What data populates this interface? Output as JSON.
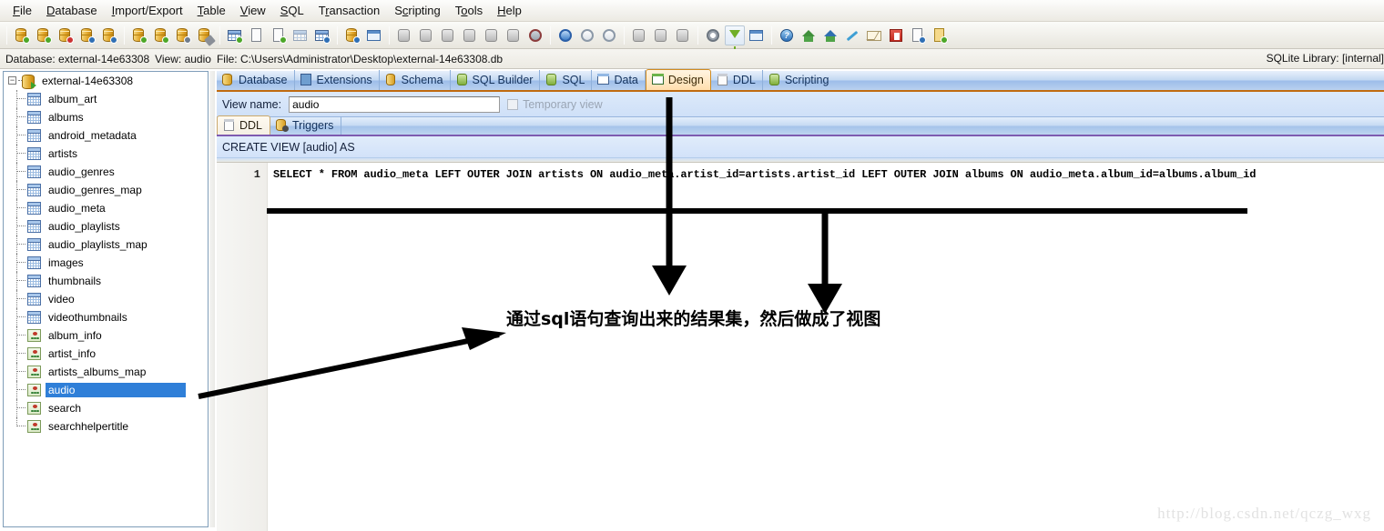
{
  "menubar": {
    "items": [
      {
        "label": "File",
        "acc": "F"
      },
      {
        "label": "Database",
        "acc": "D"
      },
      {
        "label": "Import/Export",
        "acc": "I"
      },
      {
        "label": "Table",
        "acc": "T"
      },
      {
        "label": "View",
        "acc": "V"
      },
      {
        "label": "SQL",
        "acc": "S"
      },
      {
        "label": "Transaction",
        "acc": "r"
      },
      {
        "label": "Scripting",
        "acc": "c"
      },
      {
        "label": "Tools",
        "acc": "o"
      },
      {
        "label": "Help",
        "acc": "H"
      }
    ]
  },
  "toolbar": {
    "groups": [
      {
        "buttons": [
          {
            "name": "open-database",
            "icon": "database-open-icon"
          },
          {
            "name": "new-database",
            "icon": "database-add-icon"
          },
          {
            "name": "close-database",
            "icon": "database-remove-icon"
          },
          {
            "name": "database-settings",
            "icon": "database-gear-icon"
          },
          {
            "name": "database-info",
            "icon": "database-info-icon"
          }
        ]
      },
      {
        "buttons": [
          {
            "name": "attach-database",
            "icon": "database-attach-icon"
          },
          {
            "name": "detach-database",
            "icon": "database-detach-icon"
          },
          {
            "name": "compact-database",
            "icon": "database-compact-icon"
          },
          {
            "name": "repair-database",
            "icon": "database-wrench-icon"
          }
        ]
      },
      {
        "buttons": [
          {
            "name": "new-table",
            "icon": "table-add-icon"
          },
          {
            "name": "rename-table",
            "icon": "table-text-icon"
          },
          {
            "name": "copy-table",
            "icon": "table-copy-icon"
          },
          {
            "name": "drop-table",
            "icon": "table-delete-icon"
          },
          {
            "name": "design-table",
            "icon": "table-design-icon"
          }
        ]
      },
      {
        "buttons": [
          {
            "name": "import-data",
            "icon": "import-icon"
          },
          {
            "name": "export-data",
            "icon": "export-calendar-icon"
          }
        ]
      },
      {
        "buttons": [
          {
            "name": "execute-sql-1",
            "icon": "sql-script-icon"
          },
          {
            "name": "execute-sql-2",
            "icon": "sql-script-icon"
          },
          {
            "name": "execute-sql-3",
            "icon": "sql-script-icon"
          },
          {
            "name": "execute-sql-4",
            "icon": "sql-script-icon"
          },
          {
            "name": "execute-sql-5",
            "icon": "sql-script-icon"
          },
          {
            "name": "execute-sql-6",
            "icon": "sql-script-icon"
          },
          {
            "name": "stop-sql",
            "icon": "stop-icon"
          }
        ]
      },
      {
        "buttons": [
          {
            "name": "transaction-begin",
            "icon": "transaction-begin-icon"
          },
          {
            "name": "transaction-commit",
            "icon": "transaction-commit-icon"
          },
          {
            "name": "transaction-rollback",
            "icon": "transaction-rollback-icon"
          }
        ]
      },
      {
        "buttons": [
          {
            "name": "script-run-1",
            "icon": "script-icon"
          },
          {
            "name": "script-run-2",
            "icon": "script-icon"
          },
          {
            "name": "script-run-3",
            "icon": "script-icon"
          }
        ]
      },
      {
        "buttons": [
          {
            "name": "preferences",
            "icon": "gear-icon"
          },
          {
            "name": "filter",
            "icon": "funnel-icon"
          },
          {
            "name": "window-layout",
            "icon": "window-icon"
          }
        ]
      },
      {
        "buttons": [
          {
            "name": "help",
            "icon": "help-icon"
          },
          {
            "name": "home-page",
            "icon": "home-icon"
          },
          {
            "name": "support",
            "icon": "support-icon"
          },
          {
            "name": "customize",
            "icon": "pen-icon"
          },
          {
            "name": "contact-mail",
            "icon": "mail-icon"
          },
          {
            "name": "register",
            "icon": "red-box-icon"
          },
          {
            "name": "about",
            "icon": "about-icon"
          },
          {
            "name": "updates",
            "icon": "updates-icon"
          }
        ]
      }
    ]
  },
  "infobar": {
    "database_label": "Database: external-14e63308",
    "view_label": "View: audio",
    "file_label": "File: C:\\Users\\Administrator\\Desktop\\external-14e63308.db",
    "library_label": "SQLite Library: [internal]"
  },
  "tree": {
    "root": "external-14e63308",
    "items": [
      {
        "label": "album_art",
        "kind": "table"
      },
      {
        "label": "albums",
        "kind": "table"
      },
      {
        "label": "android_metadata",
        "kind": "table"
      },
      {
        "label": "artists",
        "kind": "table"
      },
      {
        "label": "audio_genres",
        "kind": "table"
      },
      {
        "label": "audio_genres_map",
        "kind": "table"
      },
      {
        "label": "audio_meta",
        "kind": "table"
      },
      {
        "label": "audio_playlists",
        "kind": "table"
      },
      {
        "label": "audio_playlists_map",
        "kind": "table"
      },
      {
        "label": "images",
        "kind": "table"
      },
      {
        "label": "thumbnails",
        "kind": "table"
      },
      {
        "label": "video",
        "kind": "table"
      },
      {
        "label": "videothumbnails",
        "kind": "table"
      },
      {
        "label": "album_info",
        "kind": "view"
      },
      {
        "label": "artist_info",
        "kind": "view"
      },
      {
        "label": "artists_albums_map",
        "kind": "view"
      },
      {
        "label": "audio",
        "kind": "view",
        "selected": true
      },
      {
        "label": "search",
        "kind": "view"
      },
      {
        "label": "searchhelpertitle",
        "kind": "view"
      }
    ]
  },
  "tabs": [
    {
      "label": "Database",
      "icon": "database-icon",
      "active": false
    },
    {
      "label": "Extensions",
      "icon": "extensions-icon",
      "active": false
    },
    {
      "label": "Schema",
      "icon": "schema-icon",
      "active": false
    },
    {
      "label": "SQL Builder",
      "icon": "sql-builder-icon",
      "active": false
    },
    {
      "label": "SQL",
      "icon": "sql-icon",
      "active": false
    },
    {
      "label": "Data",
      "icon": "data-icon",
      "active": false
    },
    {
      "label": "Design",
      "icon": "design-icon",
      "active": true
    },
    {
      "label": "DDL",
      "icon": "ddl-icon",
      "active": false
    },
    {
      "label": "Scripting",
      "icon": "scripting-icon",
      "active": false
    }
  ],
  "design": {
    "viewname_label": "View name:",
    "viewname_value": "audio",
    "viewname_placeholder": "",
    "temporary_view_label": "Temporary view",
    "temporary_view_checked": false,
    "subtabs": [
      {
        "label": "DDL",
        "icon": "ddl-note-icon",
        "active": true
      },
      {
        "label": "Triggers",
        "icon": "trigger-icon",
        "active": false
      }
    ],
    "ddl_header": "CREATE VIEW [audio] AS",
    "line_number": "1",
    "sql": "SELECT * FROM audio_meta LEFT OUTER JOIN artists ON audio_meta.artist_id=artists.artist_id LEFT OUTER JOIN albums ON audio_meta.album_id=albums.album_id"
  },
  "annotations": {
    "note_text": "通过sql语句查询出来的结果集，然后做成了视图",
    "arrow_color": "#000000",
    "watermark": "http://blog.csdn.net/qczg_wxg"
  },
  "colors": {
    "accent_tab": "#c06a10",
    "selection": "#2f7fd8",
    "panel_blue": "#cfe0f8",
    "subtab_accent": "#7e5bb0"
  }
}
